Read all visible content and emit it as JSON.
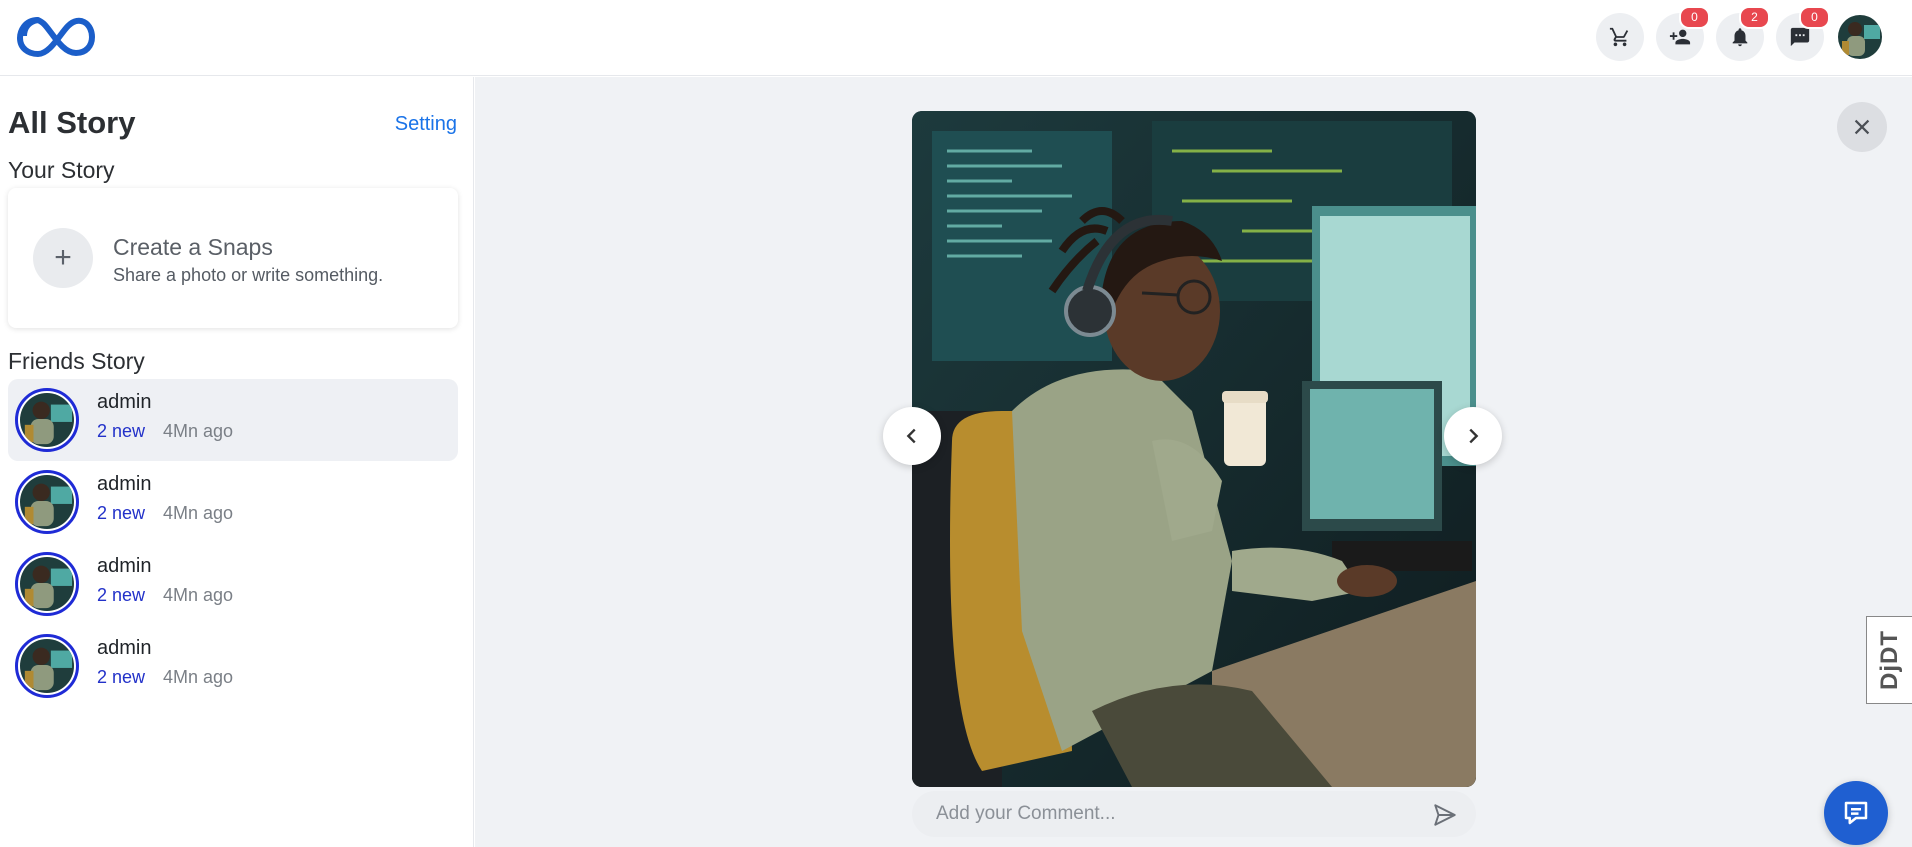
{
  "header": {
    "badges": {
      "friend_requests": "0",
      "notifications": "2",
      "messages": "0"
    }
  },
  "sidebar": {
    "title": "All Story",
    "setting_label": "Setting",
    "your_story_heading": "Your Story",
    "create": {
      "title": "Create a Snaps",
      "subtitle": "Share a photo or write something.",
      "icon": "+"
    },
    "friends_heading": "Friends Story",
    "friends": [
      {
        "name": "admin",
        "new": "2 new",
        "time": "4Mn ago",
        "active": true
      },
      {
        "name": "admin",
        "new": "2 new",
        "time": "4Mn ago",
        "active": false
      },
      {
        "name": "admin",
        "new": "2 new",
        "time": "4Mn ago",
        "active": false
      },
      {
        "name": "admin",
        "new": "2 new",
        "time": "4Mn ago",
        "active": false
      }
    ]
  },
  "viewer": {
    "comment_placeholder": "Add your Comment..."
  },
  "debug_toolbar": {
    "label_prefix": "Dj",
    "label_suffix": "DT"
  },
  "colors": {
    "accent": "#1a73e8",
    "story_ring": "#1f2bd6",
    "badge": "#e8474f",
    "chat_fab": "#1f5fd1"
  }
}
